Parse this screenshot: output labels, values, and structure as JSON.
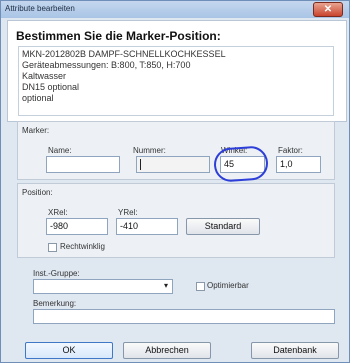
{
  "window": {
    "title": "Attribute bearbeiten",
    "close_icon": "close-icon"
  },
  "header": {
    "title": "Bestimmen Sie die Marker-Position:",
    "lines": [
      "MKN-2012802B  DAMPF-SCHNELLKOCHKESSEL",
      "Geräteabmessungen: B:800, T:850, H:700",
      "Kaltwasser",
      "DN15 optional",
      "optional"
    ]
  },
  "marker": {
    "group_label": "Marker:",
    "name_label": "Name:",
    "name_value": "",
    "nummer_label": "Nummer:",
    "nummer_value": "",
    "winkel_label": "Winkel:",
    "winkel_value": "45",
    "faktor_label": "Faktor:",
    "faktor_value": "1,0"
  },
  "position": {
    "group_label": "Position:",
    "xrel_label": "XRel:",
    "xrel_value": "-980",
    "yrel_label": "YRel:",
    "yrel_value": "-410",
    "standard_button": "Standard",
    "rechtwinklig_label": "Rechtwinklig"
  },
  "inst": {
    "gruppe_label": "Inst.-Gruppe:",
    "gruppe_value": "",
    "optimierbar_label": "Optimierbar"
  },
  "bemerkung": {
    "label": "Bemerkung:",
    "value": ""
  },
  "buttons": {
    "ok": "OK",
    "cancel": "Abbrechen",
    "datenbank": "Datenbank"
  },
  "colors": {
    "highlight": "#2d3fd8",
    "window_border": "#6f8fb8"
  }
}
